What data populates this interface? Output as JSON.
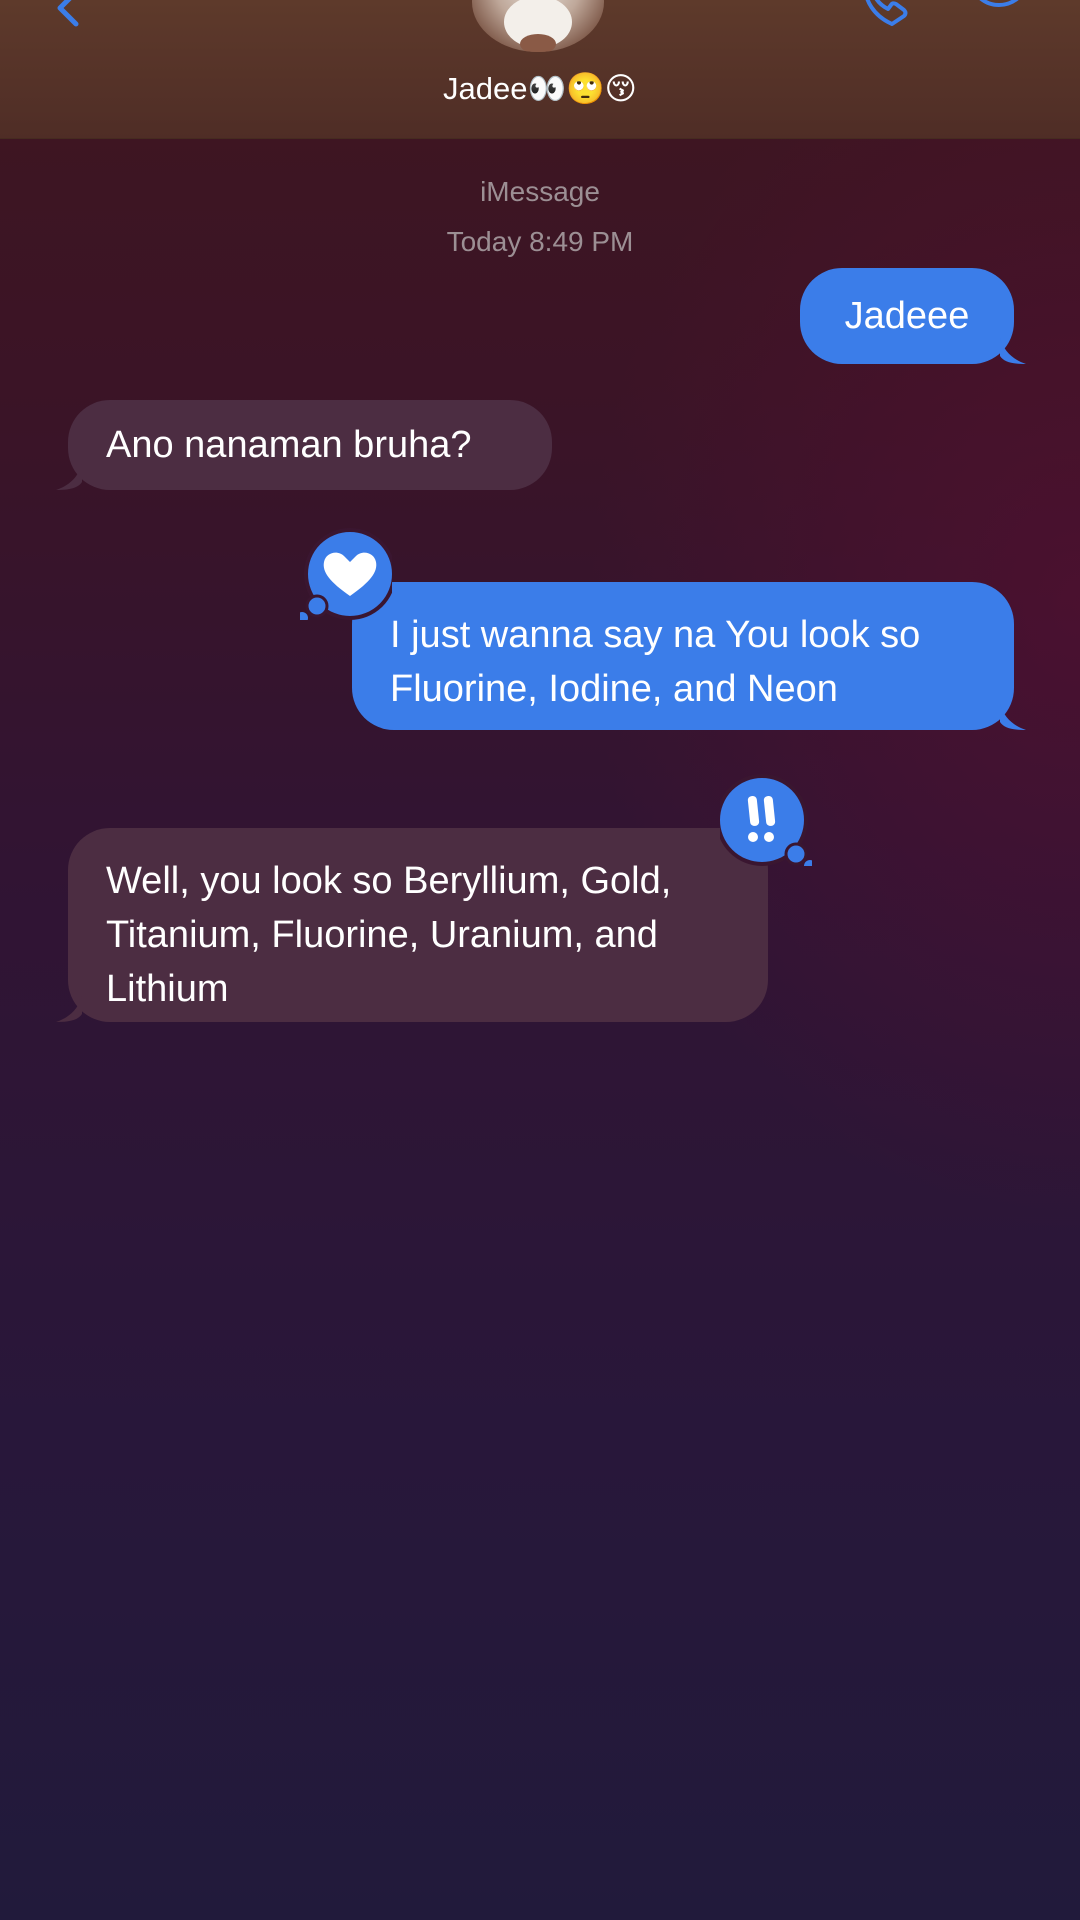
{
  "header": {
    "contact_name": "Jadee👀🙄😚",
    "icons": [
      "back-chevron",
      "avatar",
      "phone",
      "info"
    ]
  },
  "thread": {
    "service": "iMessage",
    "timestamp": "Today 8:49 PM",
    "messages": [
      {
        "direction": "sent",
        "text": "Jadeee"
      },
      {
        "direction": "received",
        "text": "Ano nanaman bruha?"
      },
      {
        "direction": "sent",
        "text": "I just wanna say na You look so Fluorine, Iodine, and Neon",
        "tapback": "heart"
      },
      {
        "direction": "received",
        "text": "Well, you look so Beryllium, Gold, Titanium, Fluorine, Uranium, and Lithium",
        "tapback": "exclamation"
      }
    ]
  },
  "colors": {
    "sent_bubble": "#3b7de9",
    "received_bubble": "#4c2d42",
    "accent": "#3b7de9",
    "header_bg": "#5e3a2b"
  }
}
